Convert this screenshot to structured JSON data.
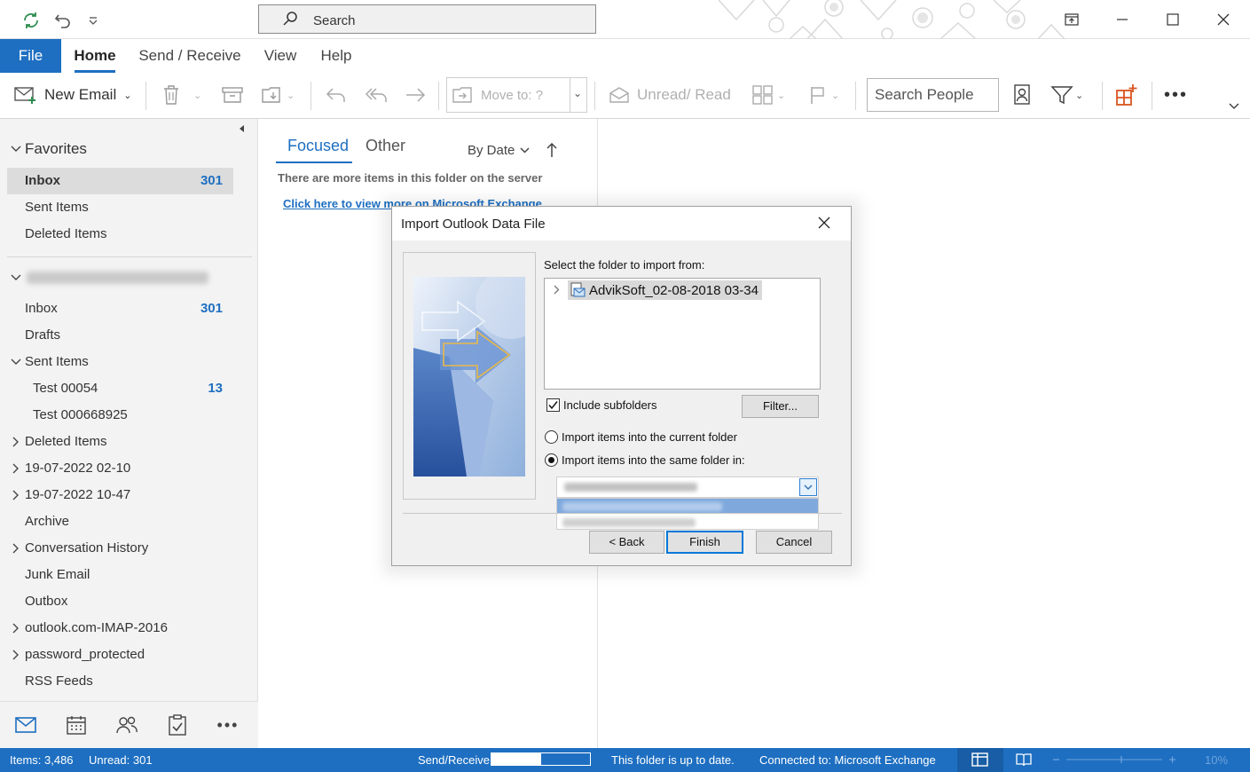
{
  "titlebar": {
    "search_placeholder": "Search",
    "icons": [
      "sync-icon",
      "undo-icon",
      "customize-quick-access-icon",
      "search-icon",
      "ribbon-display-icon",
      "minimize-icon",
      "maximize-icon",
      "close-icon"
    ]
  },
  "tabs": [
    "File",
    "Home",
    "Send / Receive",
    "View",
    "Help"
  ],
  "ribbon": {
    "new_email": "New Email",
    "move_to": "Move to: ?",
    "unread_read": "Unread/ Read",
    "search_people": "Search People"
  },
  "folders": {
    "favorites_header": "Favorites",
    "favorites": [
      {
        "label": "Inbox",
        "count": "301"
      },
      {
        "label": "Sent Items",
        "count": ""
      },
      {
        "label": "Deleted Items",
        "count": ""
      }
    ],
    "account_items": [
      {
        "label": "Inbox",
        "count": "301"
      },
      {
        "label": "Drafts",
        "count": ""
      },
      {
        "label": "Sent Items",
        "count": ""
      },
      {
        "label": "Test 00054",
        "count": "13"
      },
      {
        "label": "Test 000668925",
        "count": ""
      },
      {
        "label": "Deleted Items",
        "count": ""
      },
      {
        "label": "19-07-2022 02-10",
        "count": ""
      },
      {
        "label": "19-07-2022 10-47",
        "count": ""
      },
      {
        "label": "Archive",
        "count": ""
      },
      {
        "label": "Conversation History",
        "count": ""
      },
      {
        "label": "Junk Email",
        "count": ""
      },
      {
        "label": "Outbox",
        "count": ""
      },
      {
        "label": "outlook.com-IMAP-2016",
        "count": ""
      },
      {
        "label": "password_protected",
        "count": ""
      },
      {
        "label": "RSS Feeds",
        "count": ""
      }
    ]
  },
  "message_list": {
    "tab_focused": "Focused",
    "tab_other": "Other",
    "sort_by": "By Date",
    "more_items_notice": "There are more items in this folder on the server",
    "exchange_link": "Click here to view more on Microsoft Exchange"
  },
  "dialog": {
    "title": "Import Outlook Data File",
    "select_folder_label": "Select the folder to import from:",
    "tree_item": "AdvikSoft_02-08-2018 03-34",
    "include_subfolders": "Include subfolders",
    "include_subfolders_checked": true,
    "filter_button": "Filter...",
    "radio_current": "Import items into the current folder",
    "radio_same": "Import items into the same folder in:",
    "selected_radio": "same",
    "back_button": "< Back",
    "finish_button": "Finish",
    "cancel_button": "Cancel"
  },
  "status": {
    "items": "Items: 3,486",
    "unread": "Unread: 301",
    "send_receive": "Send/Receive",
    "send_receive_progress": 0.5,
    "folder_status": "This folder is up to date.",
    "connection": "Connected to: Microsoft Exchange",
    "zoom": "10%"
  },
  "colors": {
    "accent": "#1e6fc1",
    "status_bar": "#1e6fc1",
    "folder_pane": "#f3f3f3",
    "dialog_bg": "#f0f0f0",
    "dialog_default_button_border": "#0078d7"
  }
}
